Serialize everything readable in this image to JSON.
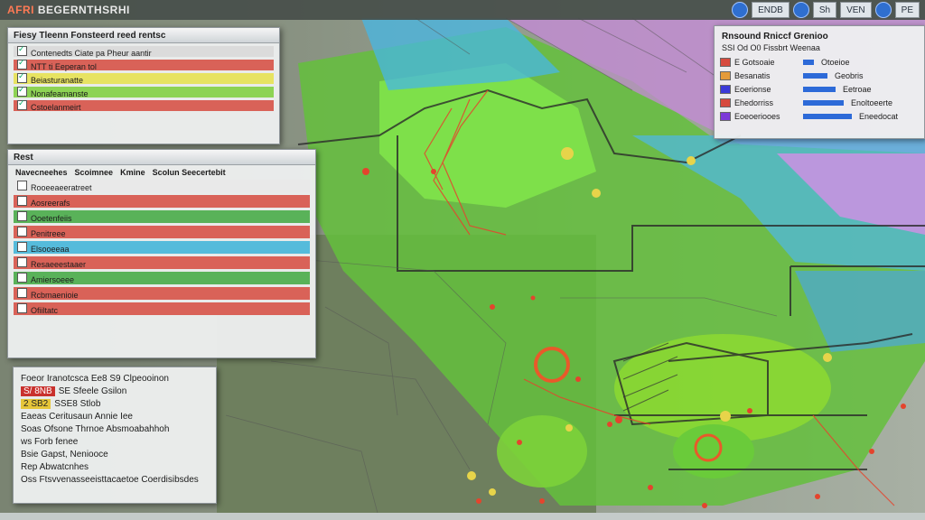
{
  "app": {
    "title_prefix": "AFRI",
    "title_rest": "BEGERNTHSRHI"
  },
  "topbar": {
    "buttons": [
      "ENDB",
      "Sh",
      "VEN",
      "PE"
    ]
  },
  "layers_panel": {
    "header": "Fiesy Tleenn Fonsteerd reed rentsc",
    "rows": [
      {
        "label": "Contenedts Ciate pa Pheur aantir",
        "color": "#d8d8d8"
      },
      {
        "label": "NTT ti Eeperan tol",
        "color": "#d64a3e"
      },
      {
        "label": "Beiasturanatte",
        "color": "#e6e24a"
      },
      {
        "label": "Nonafeamanste",
        "color": "#7ccf3a"
      },
      {
        "label": "Cstoelanmeirt",
        "color": "#d64a3e"
      }
    ]
  },
  "events_panel": {
    "header": "Rest",
    "columns": [
      "Navecneehes",
      "Scoimnee",
      "Kmine",
      "Scolun Seecertebit"
    ],
    "rows": [
      {
        "label": "Rooeeaeeratreet",
        "color": "#e9e9e9"
      },
      {
        "label": "Aosreerafs",
        "color": "#d64a3e"
      },
      {
        "label": "Ooetenfeiis",
        "color": "#3fa83f"
      },
      {
        "label": "Penitreee",
        "color": "#d64a3e"
      },
      {
        "label": "Elsooeeaa",
        "color": "#3bb3d8"
      },
      {
        "label": "Resaeeestaaer",
        "color": "#d64a3e"
      },
      {
        "label": "Amiersoeee",
        "color": "#3fa83f"
      },
      {
        "label": "Rcbmaenioie",
        "color": "#d64a3e"
      },
      {
        "label": "Ofiiltatc",
        "color": "#d64a3e"
      }
    ]
  },
  "status_panel": {
    "lines": [
      {
        "text": "Foeor Iranotcsca  Ee8 S9 Clpeooinon",
        "tag": "",
        "tag_style": ""
      },
      {
        "text": "SE Sfeele Gsilon",
        "tag": "S/ 8NB",
        "tag_style": "r"
      },
      {
        "text": "SSE8 Stlob",
        "tag": "2 SB2",
        "tag_style": "y"
      },
      {
        "text": "Eaeas Ceritusaun Annie Iee",
        "tag": "",
        "tag_style": ""
      },
      {
        "text": "Soas Ofsone Thrnoe Absmoabahhoh",
        "tag": "",
        "tag_style": ""
      },
      {
        "text": "ws Forb fenee",
        "tag": "",
        "tag_style": ""
      },
      {
        "text": "Bsie Gapst, Neniooce",
        "tag": "",
        "tag_style": "g"
      },
      {
        "text": "Rep Abwatcnhes",
        "tag": "",
        "tag_style": ""
      },
      {
        "text": "Oss Ftsvvenasseeisttacaetoe Coerdisibsdes",
        "tag": "",
        "tag_style": ""
      }
    ]
  },
  "legend_panel": {
    "title": "Rnsound Rniccf Grenioo",
    "subtitle": "SSI Od O0 Fissbrt Weenaa",
    "rows": [
      {
        "label": "E Gotsoaie",
        "color": "#d64a3e",
        "level": 0.2,
        "right": "Otoeioe"
      },
      {
        "label": "Besanatis",
        "color": "#e49b3a",
        "level": 0.45,
        "right": "Geobris"
      },
      {
        "label": "Eoerionse",
        "color": "#3a3ad8",
        "level": 0.6,
        "right": "Eetroae"
      },
      {
        "label": "Ehedorriss",
        "color": "#d64a3e",
        "level": 0.75,
        "right": "Enoltoeerte"
      },
      {
        "label": "Eoeoeriooes",
        "color": "#7c3ad8",
        "level": 0.9,
        "right": "Eneedocat"
      }
    ]
  },
  "colors": {
    "map_base": "#6d7a66",
    "vegetation": "#5ec93a",
    "cool": "#45b9e6",
    "purple": "#c78fe0",
    "fire": "#e4442d"
  }
}
